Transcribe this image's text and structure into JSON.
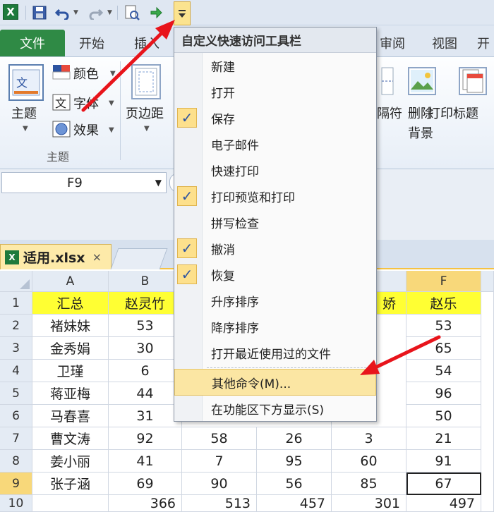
{
  "quick_access": {
    "customize_icon": "dropdown-caret"
  },
  "tabs": {
    "file": "文件",
    "home": "开始",
    "insert": "插入",
    "review": "审阅",
    "view": "视图",
    "more": "开"
  },
  "ribbon": {
    "themes_button": "主题",
    "colors": "颜色",
    "fonts": "字体",
    "effects": "效果",
    "themes_group": "主题",
    "margins": "页边距",
    "breaks": "隔符",
    "delete_bg_line1": "删除",
    "delete_bg_line2": "背景",
    "print_titles": "打印标题"
  },
  "formula_bar": {
    "namebox": "F9"
  },
  "sheet_tab": {
    "label": "适用.xlsx",
    "close": "×"
  },
  "menu": {
    "title": "自定义快速访问工具栏",
    "items": [
      {
        "label": "新建",
        "checked": false
      },
      {
        "label": "打开",
        "checked": false
      },
      {
        "label": "保存",
        "checked": true
      },
      {
        "label": "电子邮件",
        "checked": false
      },
      {
        "label": "快速打印",
        "checked": false
      },
      {
        "label": "打印预览和打印",
        "checked": true
      },
      {
        "label": "拼写检查",
        "checked": false
      },
      {
        "label": "撤消",
        "checked": true
      },
      {
        "label": "恢复",
        "checked": true
      },
      {
        "label": "升序排序",
        "checked": false
      },
      {
        "label": "降序排序",
        "checked": false
      },
      {
        "label": "打开最近使用过的文件",
        "checked": false
      }
    ],
    "more_commands": "其他命令(M)...",
    "show_below": "在功能区下方显示(S)",
    "check_glyph": "✓"
  },
  "sheet": {
    "col_headers": [
      "A",
      "B",
      "F"
    ],
    "row_headers": [
      "1",
      "2",
      "3",
      "4",
      "5",
      "6",
      "7",
      "8",
      "9",
      "10"
    ],
    "header_row": {
      "A": "汇总",
      "B": "赵灵竹",
      "E": "娇",
      "F": "赵乐"
    },
    "col_a": [
      "褚妹妹",
      "金秀娟",
      "卫瑾",
      "蒋亚梅",
      "马春喜",
      "曹文涛",
      "姜小丽",
      "张子涵"
    ],
    "col_b": [
      "53",
      "30",
      "6",
      "44",
      "31",
      "92",
      "41",
      "69"
    ],
    "col_f": [
      "53",
      "65",
      "54",
      "96",
      "50",
      "21",
      "91",
      "67"
    ],
    "row7": {
      "C": "58",
      "D": "26",
      "E": "3"
    },
    "row8": {
      "C": "7",
      "D": "95",
      "E": "60"
    },
    "row9": {
      "C": "90",
      "D": "56",
      "E": "85"
    },
    "row10": {
      "B": "366",
      "C": "513",
      "D": "457",
      "E": "301",
      "F": "497"
    }
  },
  "colors": {
    "file_tab": "#2f8a45",
    "highlight": "#ffff33",
    "arrow": "#e8141b"
  }
}
